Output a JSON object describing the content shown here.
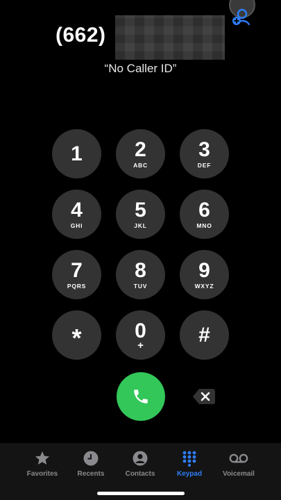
{
  "header": {
    "dialed_number": "(662)",
    "caller_id_label": "“No Caller ID”",
    "add_contact_icon": "add-contact-icon"
  },
  "keypad": {
    "keys": [
      {
        "digit": "1",
        "letters": ""
      },
      {
        "digit": "2",
        "letters": "ABC"
      },
      {
        "digit": "3",
        "letters": "DEF"
      },
      {
        "digit": "4",
        "letters": "GHI"
      },
      {
        "digit": "5",
        "letters": "JKL"
      },
      {
        "digit": "6",
        "letters": "MNO"
      },
      {
        "digit": "7",
        "letters": "PQRS"
      },
      {
        "digit": "8",
        "letters": "TUV"
      },
      {
        "digit": "9",
        "letters": "WXYZ"
      },
      {
        "digit": "*",
        "letters": ""
      },
      {
        "digit": "0",
        "letters": "+"
      },
      {
        "digit": "#",
        "letters": ""
      }
    ]
  },
  "actions": {
    "call_icon": "phone-icon",
    "delete_icon": "backspace-icon",
    "call_color": "#33c759"
  },
  "tab_bar": {
    "active_color": "#2f7df6",
    "inactive_color": "#8a8a8e",
    "tabs": [
      {
        "label": "Favorites",
        "icon": "star-icon"
      },
      {
        "label": "Recents",
        "icon": "clock-icon"
      },
      {
        "label": "Contacts",
        "icon": "person-icon"
      },
      {
        "label": "Keypad",
        "icon": "keypad-grid-icon"
      },
      {
        "label": "Voicemail",
        "icon": "voicemail-icon"
      }
    ]
  }
}
